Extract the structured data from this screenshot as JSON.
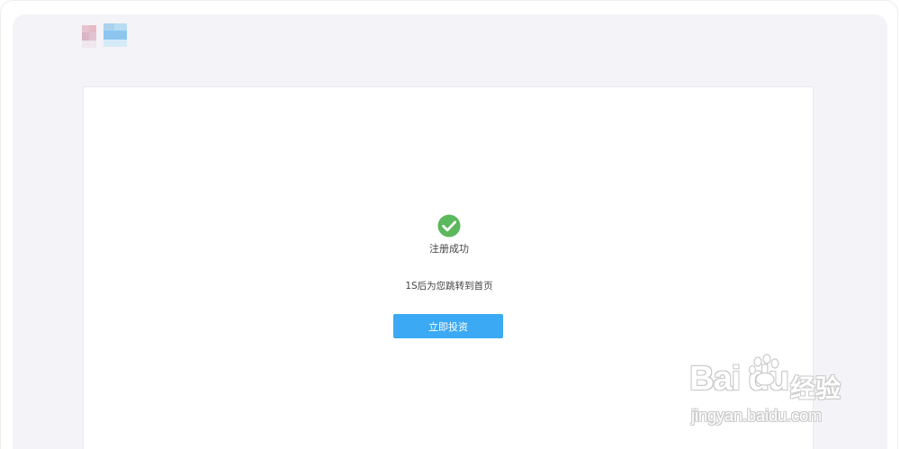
{
  "result": {
    "title": "注册成功",
    "redirect_message": "1S后为您跳转到首页",
    "icon": "check-circle-icon",
    "icon_color": "#5cb85c"
  },
  "actions": {
    "invest_label": "立即投资",
    "accent_color": "#3ba9f4"
  },
  "watermark": {
    "brand": "Bai du",
    "brand_cn": "经验",
    "url": "jingyan.baidu.com"
  },
  "header": {
    "logo": "pixelated-logo"
  }
}
